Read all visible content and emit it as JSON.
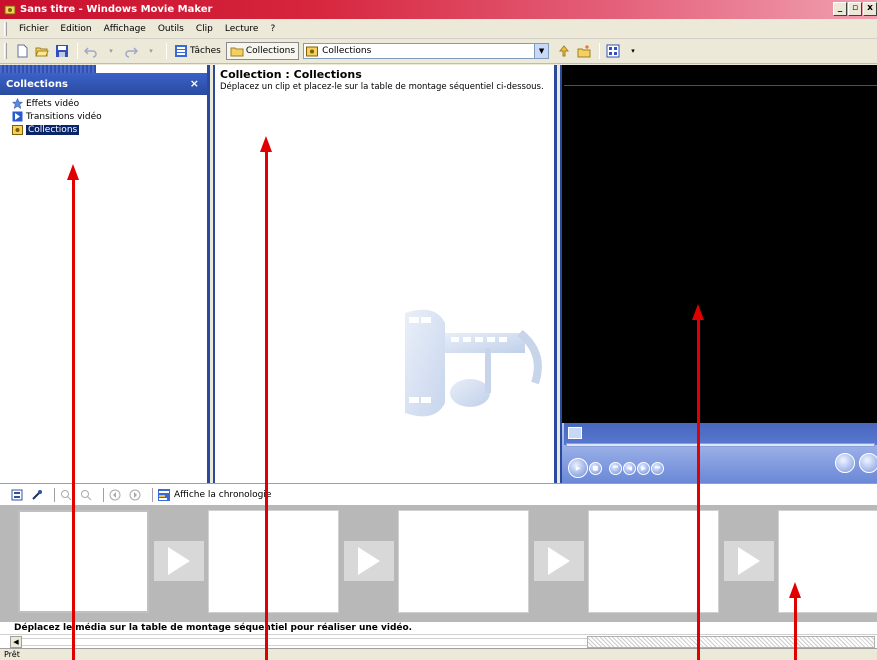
{
  "window": {
    "title": "Sans titre - Windows Movie Maker",
    "controls": [
      "_",
      "6",
      "x"
    ]
  },
  "menu": [
    "Fichier",
    "Edition",
    "Affichage",
    "Outils",
    "Clip",
    "Lecture",
    "?"
  ],
  "toolbar": {
    "tasks_label": "Tâches",
    "collections_label": "Collections",
    "combo_value": "Collections"
  },
  "collections_pane": {
    "header": "Collections",
    "close": "×",
    "items": [
      {
        "label": "Effets vidéo",
        "icon": "star-icon"
      },
      {
        "label": "Transitions vidéo",
        "icon": "transition-icon"
      },
      {
        "label": "Collections",
        "icon": "collection-folder-icon",
        "selected": true
      }
    ]
  },
  "collection_view": {
    "title": "Collection : Collections",
    "description": "Déplacez un clip et placez-le sur la table de montage séquentiel ci-dessous."
  },
  "storyboard_toolbar": {
    "timeline_label": "Affiche la chronologie"
  },
  "storyboard": {
    "hint": "Déplacez le média sur la table de montage séquentiel pour réaliser une vidéo.",
    "frame_count": 5
  },
  "status": {
    "text": "Prêt"
  },
  "colors": {
    "title_bar": "#c8102e",
    "pane_border": "#2a4aa0",
    "annotation_arrow": "#e00000"
  }
}
